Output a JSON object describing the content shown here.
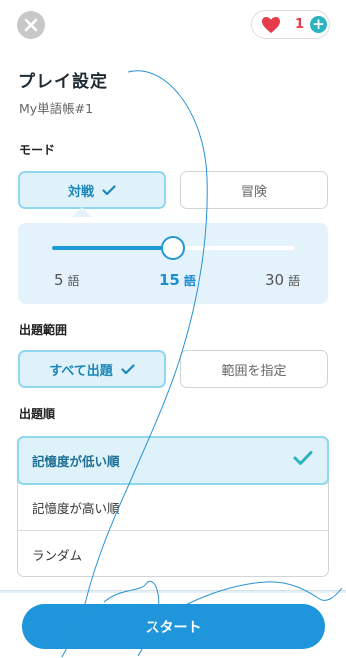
{
  "header": {
    "lives_count": "1",
    "plus_label": "+"
  },
  "page": {
    "title": "プレイ設定",
    "subtitle": "My単語帳#1"
  },
  "mode": {
    "label": "モード",
    "options": [
      "対戦",
      "冒険"
    ],
    "selected": "対戦"
  },
  "word_count": {
    "ticks": [
      {
        "value": "5",
        "unit": "語"
      },
      {
        "value": "15",
        "unit": "語"
      },
      {
        "value": "30",
        "unit": "語"
      }
    ],
    "selected_value": 15,
    "min": 5,
    "max": 30
  },
  "range": {
    "label": "出題範囲",
    "options": [
      "すべて出題",
      "範囲を指定"
    ],
    "selected": "すべて出題"
  },
  "order": {
    "label": "出題順",
    "options": [
      "記憶度が低い順",
      "記憶度が高い順",
      "ランダム"
    ],
    "selected": "記憶度が低い順"
  },
  "footer": {
    "start_label": "スタート"
  },
  "colors": {
    "accent": "#1f96dc",
    "selected_bg": "#dff2fa",
    "selected_border": "#8fd8ef",
    "check": "#2bb3c0",
    "heart": "#e53b4b"
  },
  "icons": {
    "close": "close-icon",
    "heart": "heart-icon",
    "plus": "plus-icon",
    "check": "check-icon"
  }
}
